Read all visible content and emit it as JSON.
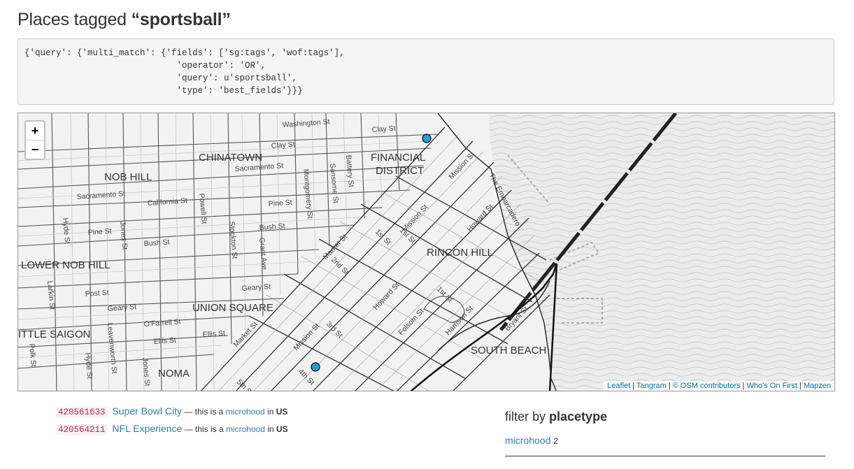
{
  "page": {
    "title_prefix": "Places tagged ",
    "title_tag": "“sportsball”"
  },
  "query_text": "{'query': {'multi_match': {'fields': ['sg:tags', 'wof:tags'],\n                             'operator': 'OR',\n                             'query': u'sportsball',\n                             'type': 'best_fields'}}}",
  "map": {
    "zoom_in": "+",
    "zoom_out": "−",
    "neighborhoods": {
      "chinatown": "CHINATOWN",
      "nob_hill": "NOB HILL",
      "financial": "FINANCIAL",
      "district": "DISTRICT",
      "rincon_hill": "RINCON HILL",
      "lower_nob_hill": "LOWER NOB HILL",
      "union_square": "UNION SQUARE",
      "little_saigon": "ITTLE SAIGON",
      "south_beach": "SOUTH BEACH",
      "noma": "NOMA"
    },
    "streets": {
      "washington": "Washington St",
      "clay1": "Clay St",
      "clay2": "Clay St",
      "sacramento1": "Sacramento St",
      "sacramento2": "Sacramento St",
      "california": "California St",
      "pine1": "Pine St",
      "pine2": "Pine St",
      "bush1": "Bush St",
      "bush2": "Bush St",
      "post": "Post St",
      "geary1": "Geary St",
      "geary2": "Geary St",
      "ofarrell": "O'Farrell St",
      "ellis1": "Ellis St",
      "ellis2": "Ellis St",
      "market1": "Market St",
      "market2": "Market St",
      "mission1": "Mission St",
      "mission2": "Mission St",
      "mission3": "Mission St",
      "howard1": "Howard St",
      "howard2": "Howard St",
      "folsom": "Folsom St",
      "harrison": "Harrison St",
      "bryant": "Bryant St",
      "embarcadero": "The Embarcadero",
      "first1": "1st St",
      "first2": "1st St",
      "first3": "1st St",
      "second": "2nd St",
      "third": "3rd St",
      "fourth": "4th St",
      "fifth": "5th St",
      "montgomery": "Montgomery St",
      "sansome": "Sansome St",
      "battery": "Battery St",
      "kearny": "Grant Ave",
      "stockton": "Stockton St",
      "powell": "Powell St",
      "jones1": "Jones St",
      "jones2": "Jones St",
      "hyde1": "Hyde St",
      "hyde2": "Hyde St",
      "larkin": "Larkin St",
      "leavenworth": "Leavenworth St",
      "polk": "Polk St"
    },
    "attribution": {
      "leaflet": "Leaflet",
      "tangram": "Tangram",
      "osm": "© OSM contributors",
      "wof": "Who's On First",
      "mapzen": "Mapzen",
      "sep": " | "
    }
  },
  "results": [
    {
      "id": "420561633",
      "name": "Super Bowl City",
      "prefix": " — this is a ",
      "placetype": "microhood",
      "in_text": " in ",
      "country": "US"
    },
    {
      "id": "420564211",
      "name": "NFL Experience",
      "prefix": " — this is a ",
      "placetype": "microhood",
      "in_text": " in ",
      "country": "US"
    }
  ],
  "filter": {
    "heading_prefix": "filter by ",
    "heading_bold": "placetype",
    "option_label": "microhood",
    "option_count": "2"
  },
  "colors": {
    "marker_fill": "#1e9fe0",
    "link": "#337ab7",
    "water": "#ececec"
  }
}
